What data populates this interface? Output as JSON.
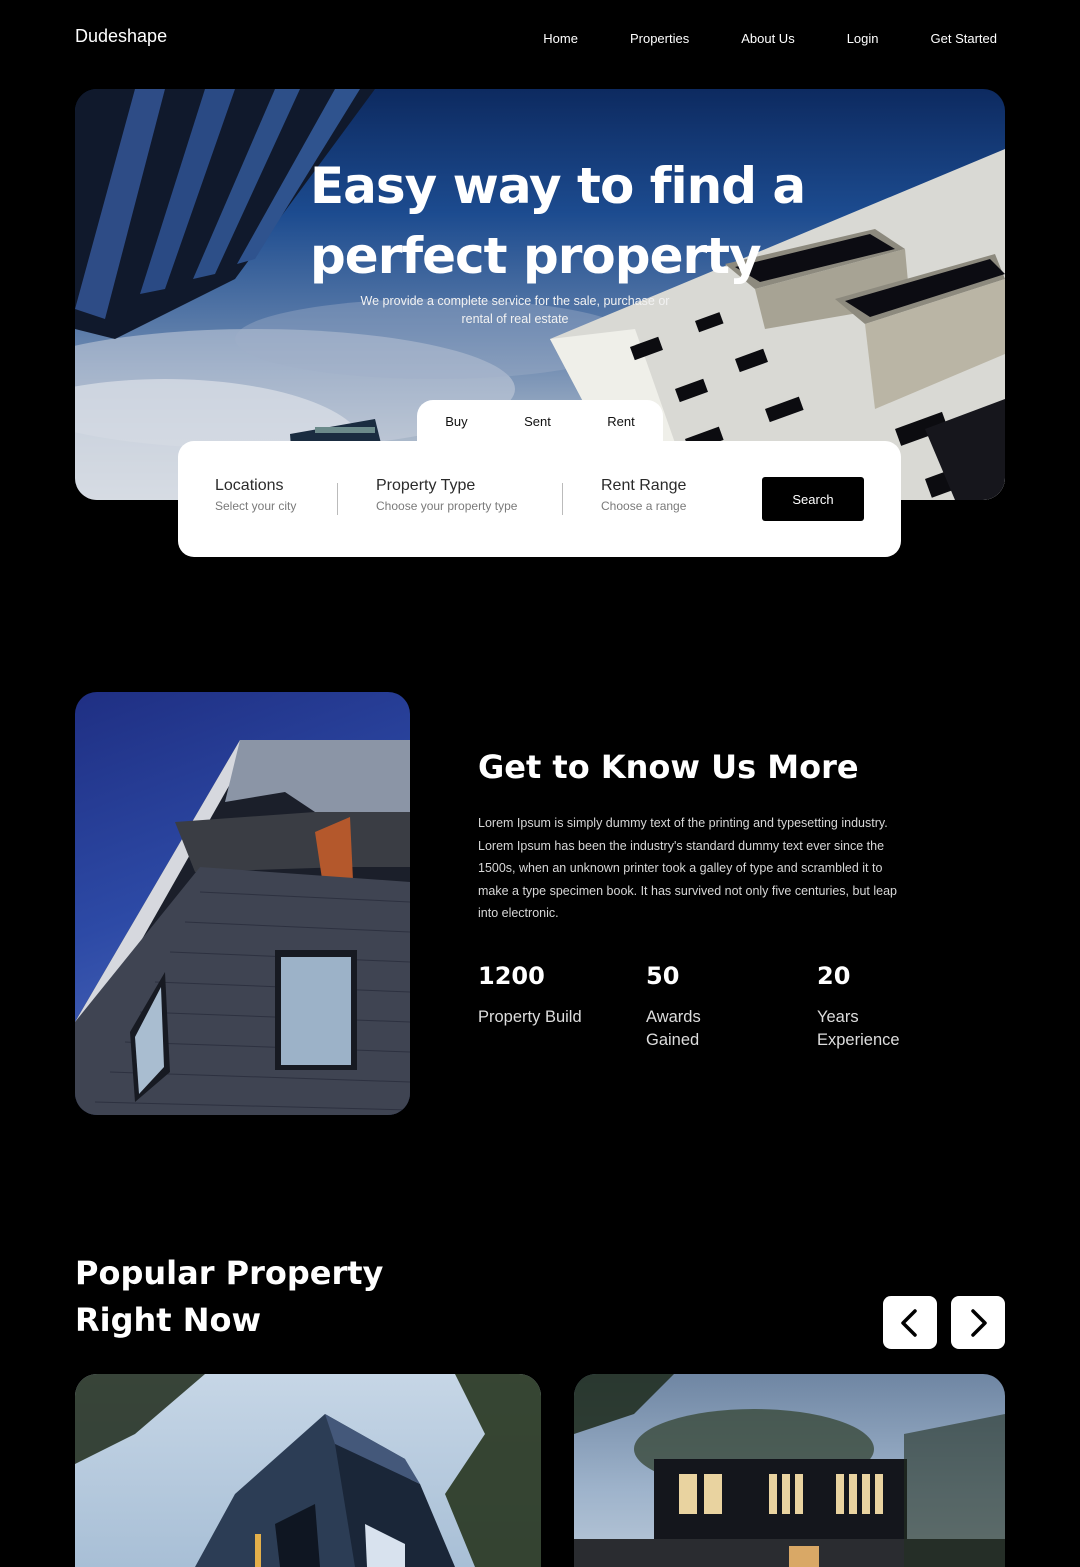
{
  "brand": "Dudeshape",
  "nav": {
    "home": "Home",
    "properties": "Properties",
    "about": "About Us",
    "login": "Login",
    "get_started": "Get Started"
  },
  "hero": {
    "title": "Easy way to find a perfect property",
    "subtitle": "We provide a complete service for the sale, purchase or rental of real estate"
  },
  "search": {
    "tabs": [
      "Buy",
      "Sent",
      "Rent"
    ],
    "locations": {
      "label": "Locations",
      "hint": "Select your city"
    },
    "type": {
      "label": "Property Type",
      "hint": "Choose your property type"
    },
    "range": {
      "label": "Rent Range",
      "hint": "Choose a range"
    },
    "button": "Search"
  },
  "about": {
    "title": "Get to Know Us More",
    "text": "Lorem Ipsum is simply dummy text of the printing and typesetting industry. Lorem Ipsum has been the industry's standard dummy text ever since the 1500s, when an unknown printer took a galley of type and scrambled it to make a type specimen book. It has survived not only five centuries, but leap into electronic.",
    "stats": [
      {
        "value": "1200",
        "label": "Property Build"
      },
      {
        "value": "50",
        "label": "Awards Gained"
      },
      {
        "value": "20",
        "label": "Years Experience"
      }
    ]
  },
  "popular": {
    "title": "Popular Property Right Now",
    "prev_icon": "chevron-left-icon",
    "next_icon": "chevron-right-icon"
  }
}
